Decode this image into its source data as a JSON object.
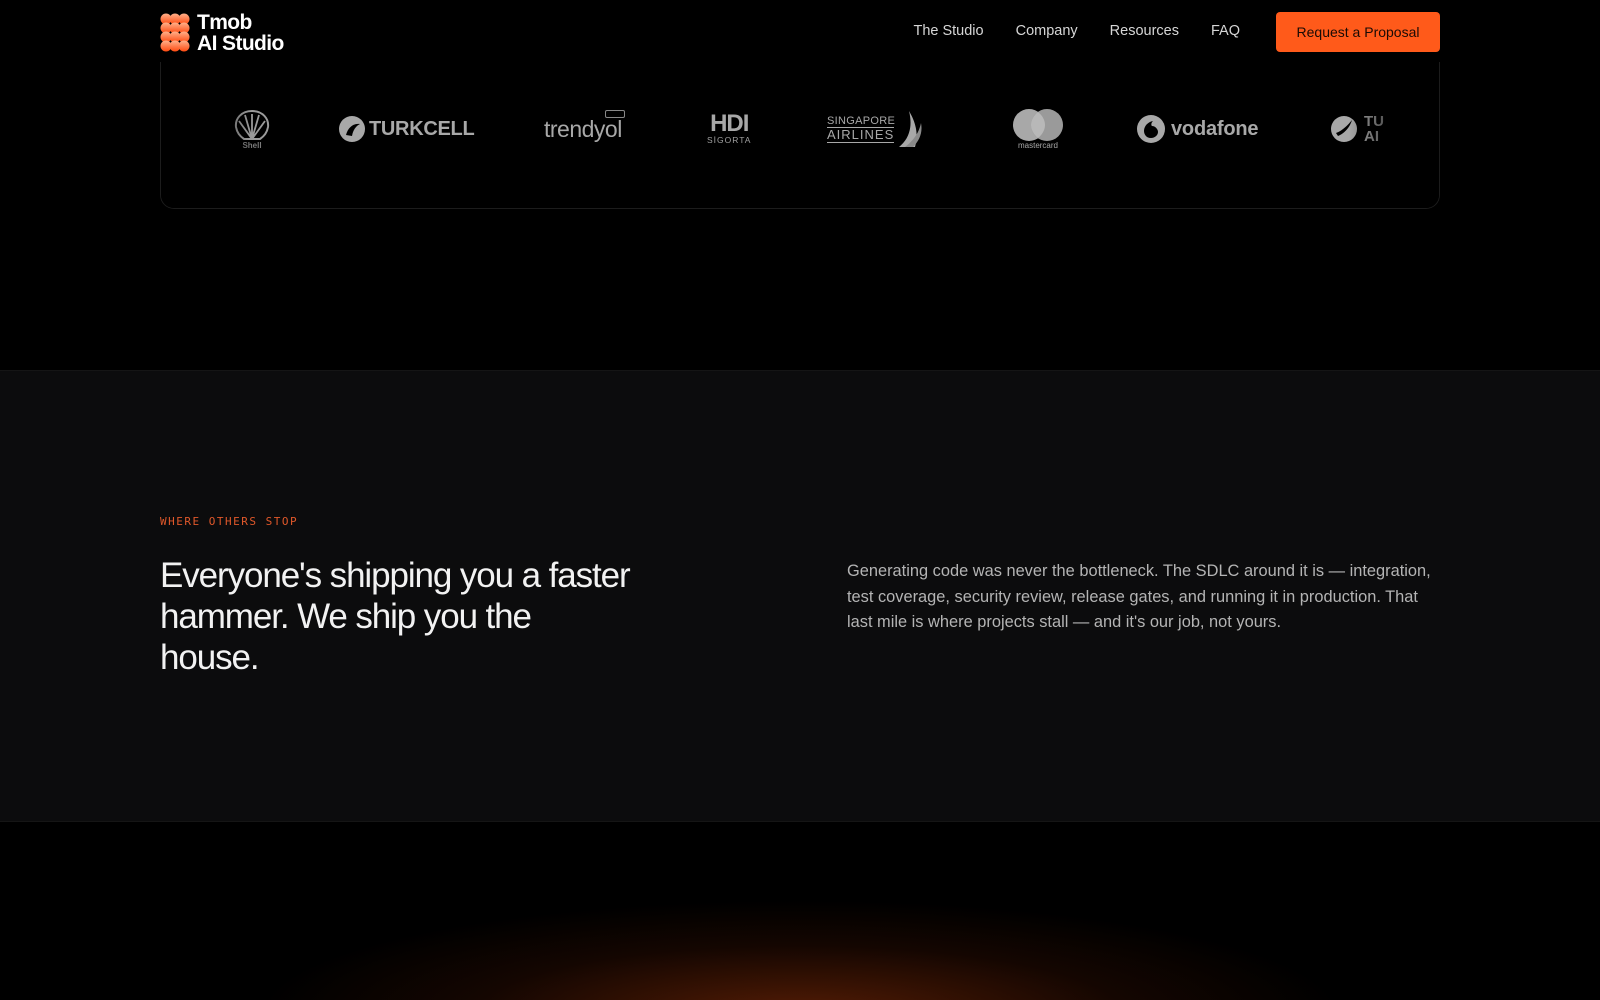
{
  "brand": {
    "name_line1": "Tmob",
    "name_line2": "AI Studio",
    "accent": "#ff5a1a"
  },
  "nav": {
    "items": [
      {
        "label": "The Studio"
      },
      {
        "label": "Company"
      },
      {
        "label": "Resources"
      },
      {
        "label": "FAQ"
      }
    ],
    "cta_label": "Request a Proposal"
  },
  "clients": {
    "logos": [
      {
        "name": "Shell",
        "label": "Shell",
        "icon": "shell-logo-icon"
      },
      {
        "name": "Turkcell",
        "label": "TURKCELL",
        "icon": "turkcell-logo-icon"
      },
      {
        "name": "Trendyol",
        "label": "trendyol",
        "icon": "trendyol-logo-icon"
      },
      {
        "name": "HDI Sigorta",
        "label": "HDI",
        "sublabel": "SİGORTA",
        "icon": "hdi-logo-icon"
      },
      {
        "name": "Singapore Airlines",
        "label": "SINGAPORE",
        "sublabel": "AIRLINES",
        "icon": "singapore-airlines-logo-icon"
      },
      {
        "name": "Mastercard",
        "label": "mastercard",
        "icon": "mastercard-logo-icon"
      },
      {
        "name": "Vodafone",
        "label": "vodafone",
        "icon": "vodafone-logo-icon"
      },
      {
        "name": "Turkish Airlines",
        "label": "TU",
        "sublabel": "AI",
        "icon": "turkish-airlines-logo-icon"
      }
    ]
  },
  "section": {
    "eyebrow": "WHERE OTHERS STOP",
    "headline": "Everyone's shipping you a faster hammer. We ship you the house.",
    "body": "Generating code was never the bottleneck. The SDLC around it is — integration, test coverage, security review, release gates, and running it in production. That last mile is where projects stall — and it's our job, not yours."
  }
}
